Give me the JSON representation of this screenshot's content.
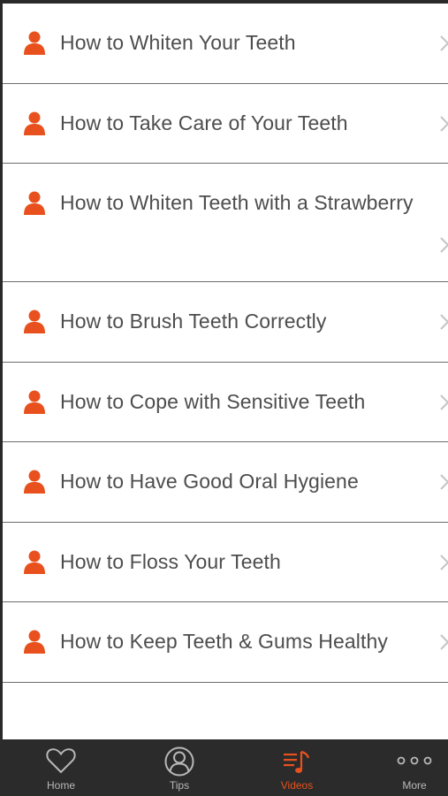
{
  "colors": {
    "accent": "#e8511d",
    "text": "#4d4d4d",
    "tab_text": "#b8b8b8",
    "tabbar_bg": "#2b2b2b"
  },
  "list": {
    "items": [
      {
        "label": "How to Whiten Your Teeth",
        "icon": "person-icon"
      },
      {
        "label": "How to Take Care of Your Teeth",
        "icon": "person-icon"
      },
      {
        "label": "How to Whiten Teeth with a Strawberry",
        "icon": "person-icon"
      },
      {
        "label": "How to Brush Teeth Correctly",
        "icon": "person-icon"
      },
      {
        "label": "How to Cope with Sensitive Teeth",
        "icon": "person-icon"
      },
      {
        "label": "How to Have Good Oral Hygiene",
        "icon": "person-icon"
      },
      {
        "label": "How to Floss Your Teeth",
        "icon": "person-icon"
      },
      {
        "label": "How to Keep Teeth & Gums Healthy",
        "icon": "person-icon"
      }
    ]
  },
  "tabbar": {
    "tabs": [
      {
        "label": "Home",
        "icon": "heart-icon"
      },
      {
        "label": "Tips",
        "icon": "user-circle-icon"
      },
      {
        "label": "Videos",
        "icon": "music-list-icon",
        "active": true
      },
      {
        "label": "More",
        "icon": "more-dots-icon"
      }
    ]
  }
}
